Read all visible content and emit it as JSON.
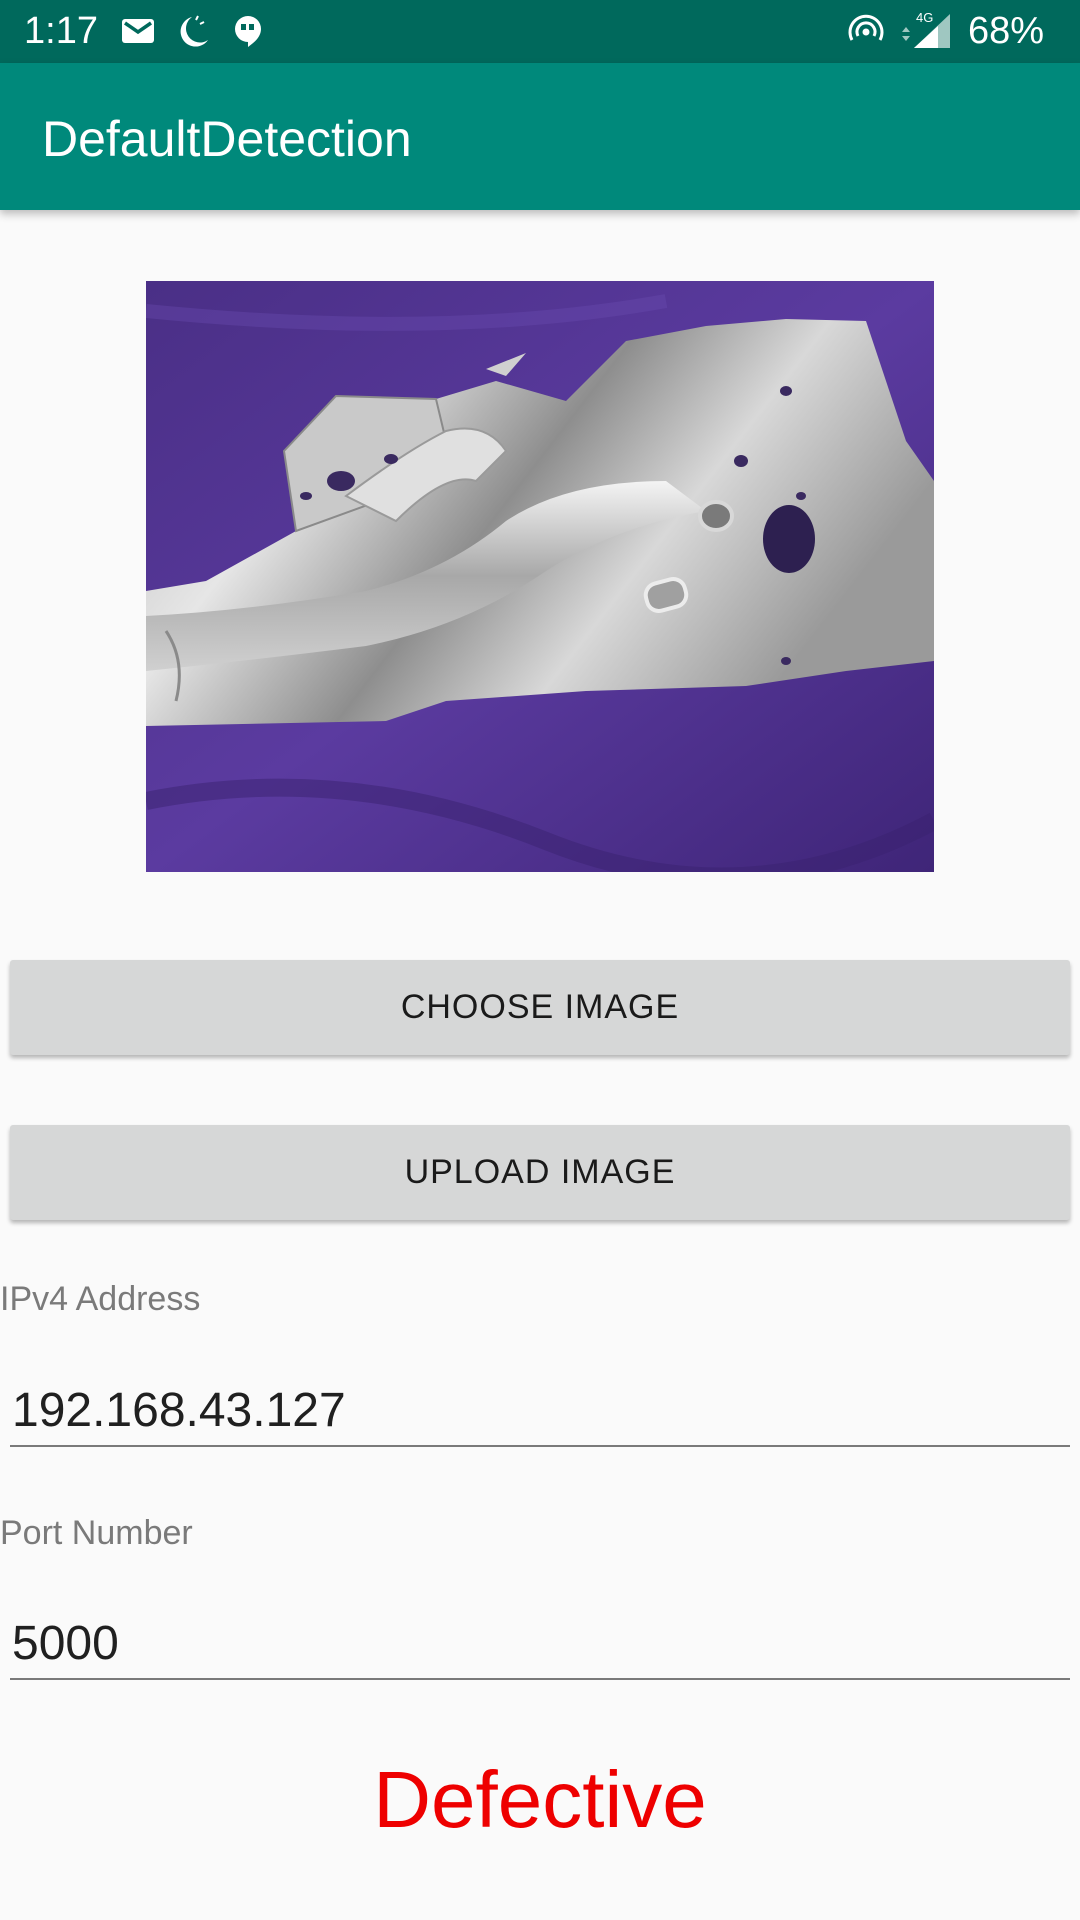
{
  "status_bar": {
    "time": "1:17",
    "battery": "68%",
    "network": "4G",
    "icons": [
      "gmail-icon",
      "do-not-disturb-moon-icon",
      "hangouts-icon",
      "hotspot-icon",
      "signal-4g-icon"
    ],
    "background_color": "#00695c"
  },
  "app_bar": {
    "title": "DefaultDetection",
    "background_color": "#00897b"
  },
  "image": {
    "subject": "metal-car-body-panel-on-purple-cloth"
  },
  "buttons": {
    "choose_label": "CHOOSE IMAGE",
    "upload_label": "UPLOAD IMAGE"
  },
  "fields": {
    "ip_label": "IPv4 Address",
    "ip_value": "192.168.43.127",
    "port_label": "Port Number",
    "port_value": "5000"
  },
  "result": {
    "text": "Defective",
    "color": "#ee0000"
  }
}
